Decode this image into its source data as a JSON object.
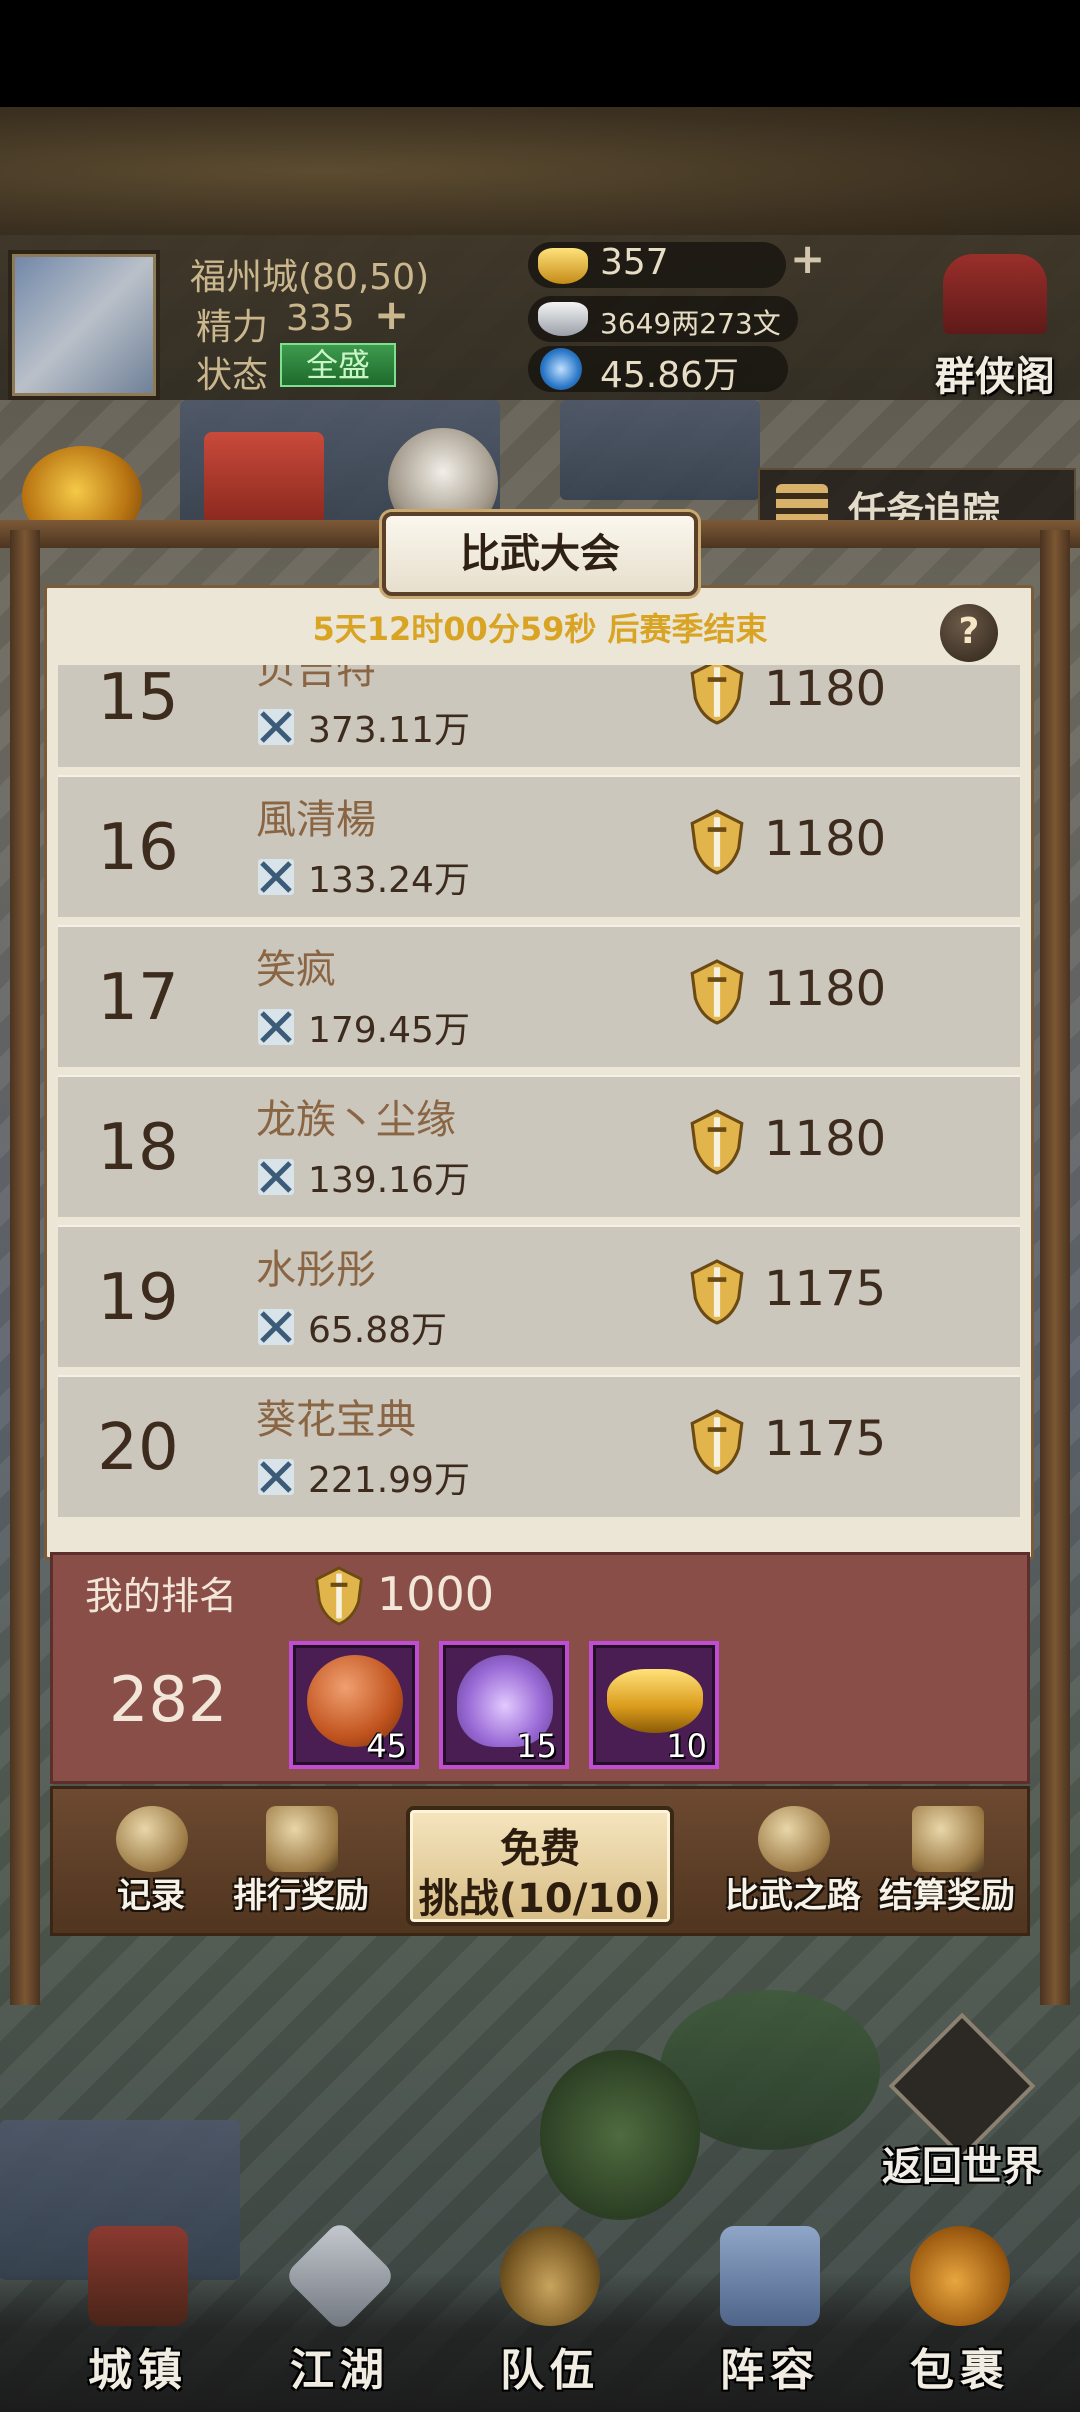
{
  "hud": {
    "location": "福州城(80,50)",
    "energy_label": "精力",
    "energy_value": "335",
    "state_label": "状态",
    "state_value": "全盛",
    "gold": "357",
    "silver": "3649两273文",
    "power_currency": "45.86万",
    "guild_label": "群侠阁"
  },
  "task_tracker": {
    "label": "任务追踪"
  },
  "panel": {
    "title": "比武大会",
    "countdown": "5天12时00分59秒 后赛季结束",
    "help": "?"
  },
  "ranking": [
    {
      "rank": "15",
      "name": "贝吉特",
      "power": "373.11万",
      "score": "1180"
    },
    {
      "rank": "16",
      "name": "風清楊",
      "power": "133.24万",
      "score": "1180"
    },
    {
      "rank": "17",
      "name": "笑疯",
      "power": "179.45万",
      "score": "1180"
    },
    {
      "rank": "18",
      "name": "龙族丶尘缘",
      "power": "139.16万",
      "score": "1180"
    },
    {
      "rank": "19",
      "name": "水彤彤",
      "power": "65.88万",
      "score": "1175"
    },
    {
      "rank": "20",
      "name": "葵花宝典",
      "power": "221.99万",
      "score": "1175"
    }
  ],
  "my_rank": {
    "label": "我的排名",
    "score": "1000",
    "rank": "282",
    "rewards": [
      {
        "icon": "crossed-swords-token-icon",
        "count": "45"
      },
      {
        "icon": "purple-powder-icon",
        "count": "15"
      },
      {
        "icon": "gold-ingot-icon",
        "count": "10"
      }
    ]
  },
  "actions": {
    "records": "记录",
    "rank_rewards": "排行奖励",
    "challenge_line1": "免费",
    "challenge_line2": "挑战(10/10)",
    "path": "比武之路",
    "settle_rewards": "结算奖励"
  },
  "return_world": "返回世界",
  "bottom_nav": [
    "城镇",
    "江湖",
    "队伍",
    "阵容",
    "包裹"
  ],
  "colors": {
    "countdown": "#d9a424",
    "state_green": "#3d9b4d",
    "my_rank_bg": "#8a4e48",
    "reward_border": "#c04ed4"
  }
}
